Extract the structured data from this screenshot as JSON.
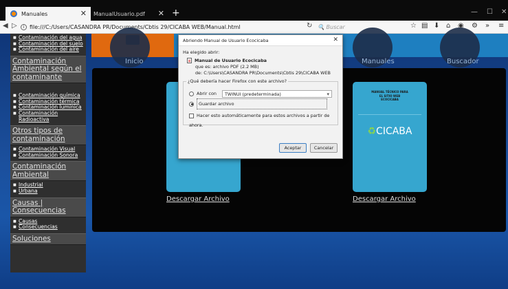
{
  "browser": {
    "active_tab": "Manuales",
    "inactive_tab": "ManualUsuario.pdf",
    "url": "file:///C:/Users/CASANDRA PR/Documents/Cbtis 29/CICABA WEB/Manual.html",
    "search_placeholder": "Buscar"
  },
  "sidebar": {
    "group1": [
      "Contaminación del agua",
      "Contaminación del suelo",
      "Contaminación del aire"
    ],
    "head1": "Contaminación Ambiental según el contaminante",
    "group2": [
      "Contaminación química",
      "Contaminación térmica",
      "Contaminación lumínica",
      "Contaminación Radioactiva"
    ],
    "head2": "Otros tipos de contaminación",
    "group3": [
      "Contaminación Visual",
      "Contaminación Sonora"
    ],
    "head3": "Contaminación Ambiental",
    "group4": [
      "Industrial",
      "Urbana"
    ],
    "head4": "Causas | Consecuencias",
    "group5": [
      "Causas",
      "Consecuencias"
    ],
    "head5": "Soluciones"
  },
  "topnav": {
    "inicio": "Inicio",
    "manuales": "Manuales",
    "buscador": "Buscador"
  },
  "content": {
    "card_title": "Manual Técnico para el Sitio Web Ecocicaba",
    "card_logo": "CICABA",
    "download_label": "Descargar Archivo"
  },
  "dialog": {
    "title": "Abriendo Manual de Usuario Ecocicaba",
    "chosen": "Ha elegido abrir:",
    "filename": "Manual de Usuario Ecocicaba",
    "type_prefix": "que es:",
    "type_value": "archivo PDF (2.2 MB)",
    "from_prefix": "de:",
    "from_value": "C:\\Users\\CASANDRA PR\\Documents\\Cbtis 29\\CICABA WEB",
    "question": "¿Qué debería hacer Firefox con este archivo?",
    "open_with": "Abrir con",
    "app": "TWINUI (predeterminada)",
    "save": "Guardar archivo",
    "auto": "Hacer esto automáticamente para estos archivos a partir de ahora.",
    "accept": "Aceptar",
    "cancel": "Cancelar"
  }
}
